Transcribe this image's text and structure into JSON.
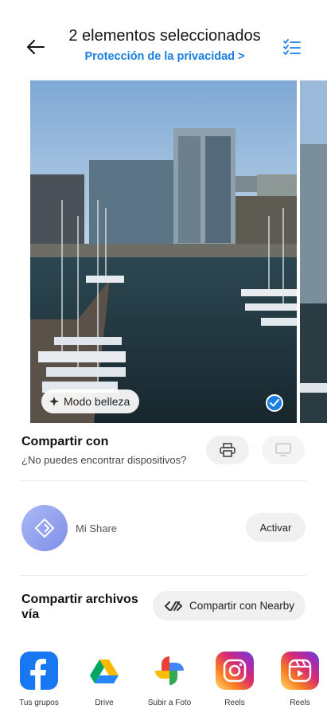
{
  "header": {
    "title": "2 elementos seleccionados",
    "privacy_link": "Protección de la privacidad >",
    "back_icon": "arrow-left-icon",
    "select_icon": "checklist-icon",
    "accent_color": "#1a7fe0"
  },
  "photos": {
    "beauty_chip_label": "Modo belleza",
    "selected": true
  },
  "share_with": {
    "title": "Compartir con",
    "subtitle": "¿No puedes encontrar dispositivos?",
    "printer_icon": "printer-icon",
    "screen_icon": "screen-icon"
  },
  "mi_share": {
    "label": "Mi Share",
    "activate_label": "Activar"
  },
  "share_files": {
    "title": "Compartir archivos vía",
    "nearby_label": "Compartir con Nearby"
  },
  "apps": [
    {
      "label": "Tus grupos",
      "icon": "facebook-icon"
    },
    {
      "label": "Drive",
      "icon": "drive-icon"
    },
    {
      "label": "Subir a Foto",
      "icon": "photos-icon"
    },
    {
      "label": "Reels",
      "icon": "instagram-icon"
    },
    {
      "label": "Reels",
      "icon": "instagram-reels-icon"
    }
  ]
}
